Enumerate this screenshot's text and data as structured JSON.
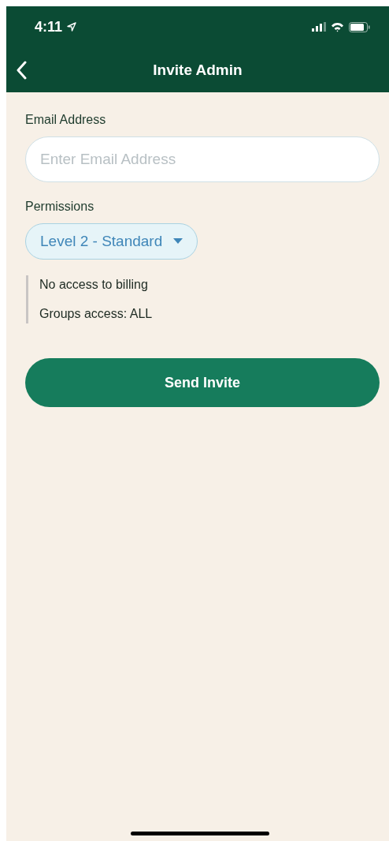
{
  "status_bar": {
    "time": "4:11"
  },
  "nav_bar": {
    "title": "Invite Admin"
  },
  "email": {
    "label": "Email Address",
    "placeholder": "Enter Email Address"
  },
  "permissions": {
    "label": "Permissions",
    "value": "Level 2 - Standard",
    "notes": [
      "No access to billing",
      "Groups access: ALL"
    ]
  },
  "buttons": [
    "Send Invite"
  ]
}
